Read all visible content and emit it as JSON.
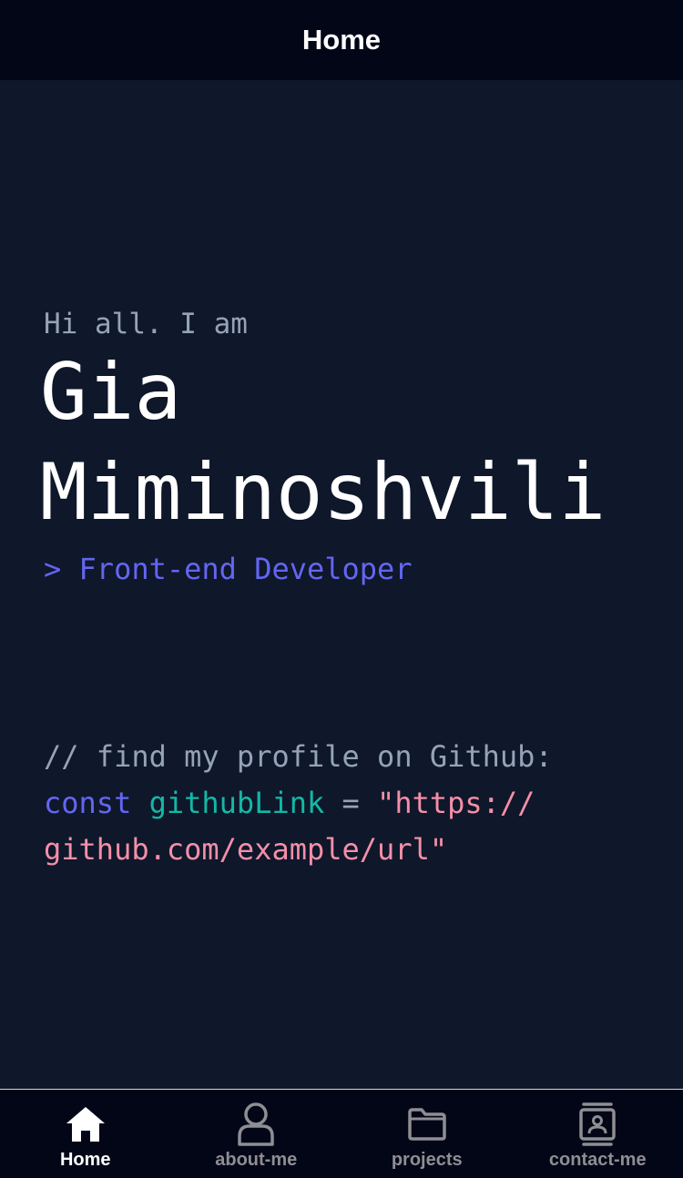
{
  "header": {
    "title": "Home"
  },
  "hero": {
    "greeting": "Hi all. I am",
    "name_first": "Gia",
    "name_last": "Miminoshvili",
    "role": "> Front-end Developer"
  },
  "code": {
    "comment": "// find my profile on Github:",
    "keyword": "const",
    "variable": "githubLink",
    "operator": "=",
    "string_part1": "\"https://",
    "string_part2": "github.com/example/url\""
  },
  "tabbar": {
    "tabs": [
      {
        "label": "Home",
        "icon": "home-icon",
        "active": true
      },
      {
        "label": "about-me",
        "icon": "user-icon",
        "active": false
      },
      {
        "label": "projects",
        "icon": "folder-icon",
        "active": false
      },
      {
        "label": "contact-me",
        "icon": "contact-card-icon",
        "active": false
      }
    ]
  },
  "colors": {
    "background": "#0f172a",
    "bar_background": "#020617",
    "accent": "#6366f1",
    "variable": "#14b8a6",
    "string": "#f48fa8",
    "muted": "#94a3b8",
    "tab_inactive": "#8e8e93"
  }
}
